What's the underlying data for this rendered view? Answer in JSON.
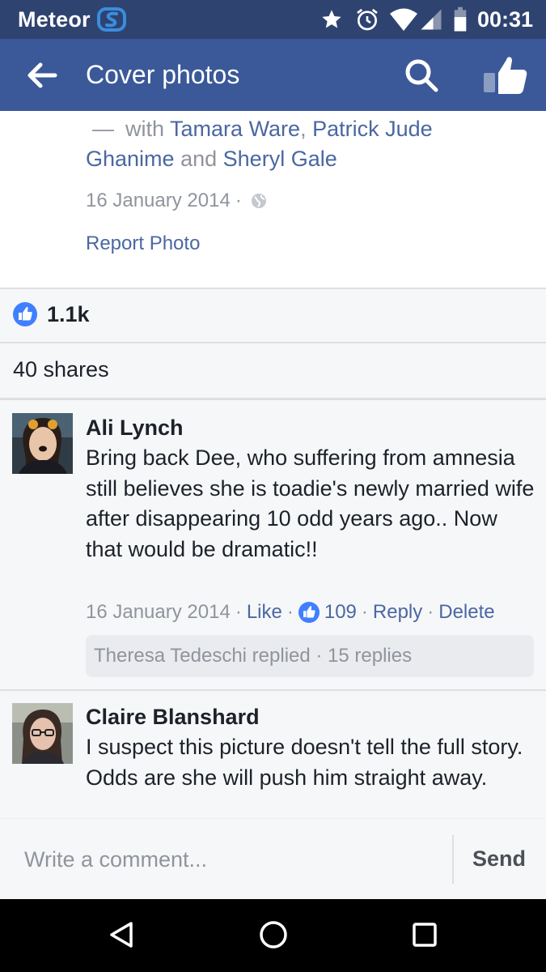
{
  "status_bar": {
    "carrier": "Meteor",
    "time": "00:31",
    "icons": [
      "meteor-logo-icon",
      "star-icon",
      "alarm-icon",
      "wifi-icon",
      "signal-icon",
      "battery-icon"
    ]
  },
  "app_bar": {
    "title": "Cover photos",
    "icons": [
      "back-arrow-icon",
      "search-icon",
      "thumbs-up-icon"
    ]
  },
  "photo_info": {
    "tag_prefix": "with",
    "tagged_people": [
      "Tamara Ware",
      "Patrick Jude Ghanime",
      "Sheryl Gale"
    ],
    "separator_comma": ",",
    "separator_and": "and",
    "date": "16 January 2014",
    "date_dot": "·",
    "privacy_icon": "globe-icon",
    "report_label": "Report Photo"
  },
  "stats": {
    "reaction_count": "1.1k",
    "shares": "40 shares"
  },
  "comments": [
    {
      "author": "Ali Lynch",
      "text": "Bring back Dee, who suffering from amnesia still believes she is toadie's newly married wife after disappearing 10 odd years ago.. Now that would be dramatic!!",
      "date": "16 January 2014",
      "like_label": "Like",
      "like_count": "109",
      "reply_label": "Reply",
      "delete_label": "Delete",
      "replies_summary": "Theresa Tedeschi replied · 15 replies"
    },
    {
      "author": "Claire Blanshard",
      "text": "I suspect this picture doesn't tell the full story. Odds are she will push him straight away."
    }
  ],
  "composer": {
    "placeholder": "Write a comment...",
    "send_label": "Send"
  },
  "colors": {
    "status_bar": "#2e4370",
    "app_bar": "#3b5998",
    "link": "#4b67a1",
    "like_blue": "#4080ff"
  }
}
